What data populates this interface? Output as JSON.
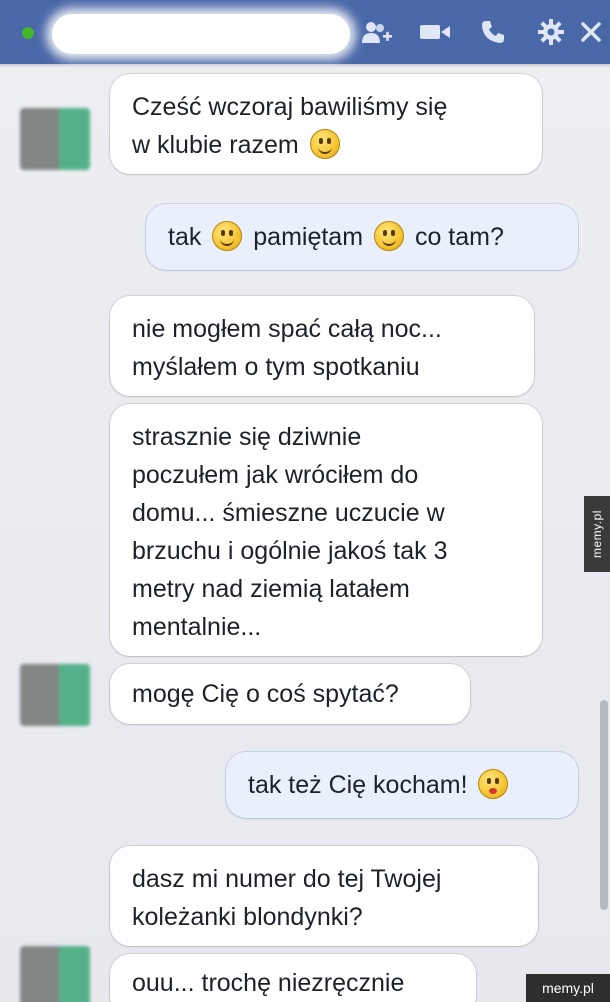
{
  "header": {
    "online_color": "#42b72a",
    "icons": [
      "add-person-icon",
      "video-call-icon",
      "phone-icon",
      "gear-icon",
      "close-icon"
    ]
  },
  "messages": [
    {
      "dir": "in",
      "lines": [
        "Cześć wczoraj bawiliśmy się",
        "w klubie razem"
      ]
    },
    {
      "dir": "out",
      "p1": "tak",
      "p2": "pamiętam",
      "p3": "co tam?"
    },
    {
      "dir": "in",
      "lines": [
        "nie mogłem spać całą noc...",
        "myślałem o tym spotkaniu"
      ]
    },
    {
      "dir": "in",
      "lines": [
        "strasznie się dziwnie",
        "poczułem jak wróciłem do",
        "domu... śmieszne uczucie w",
        "brzuchu i ogólnie jakoś tak 3",
        "metry nad ziemią latałem",
        "mentalnie..."
      ]
    },
    {
      "dir": "in",
      "text": "mogę Cię o coś spytać?"
    },
    {
      "dir": "out",
      "text": "tak też Cię kocham!"
    },
    {
      "dir": "in",
      "lines": [
        "dasz mi numer do tej Twojej",
        "koleżanki blondynki?"
      ]
    },
    {
      "dir": "in",
      "text": "ouu... trochę niezręcznie"
    }
  ],
  "watermarks": {
    "side": "memy.pl",
    "corner": "memy.pl"
  }
}
